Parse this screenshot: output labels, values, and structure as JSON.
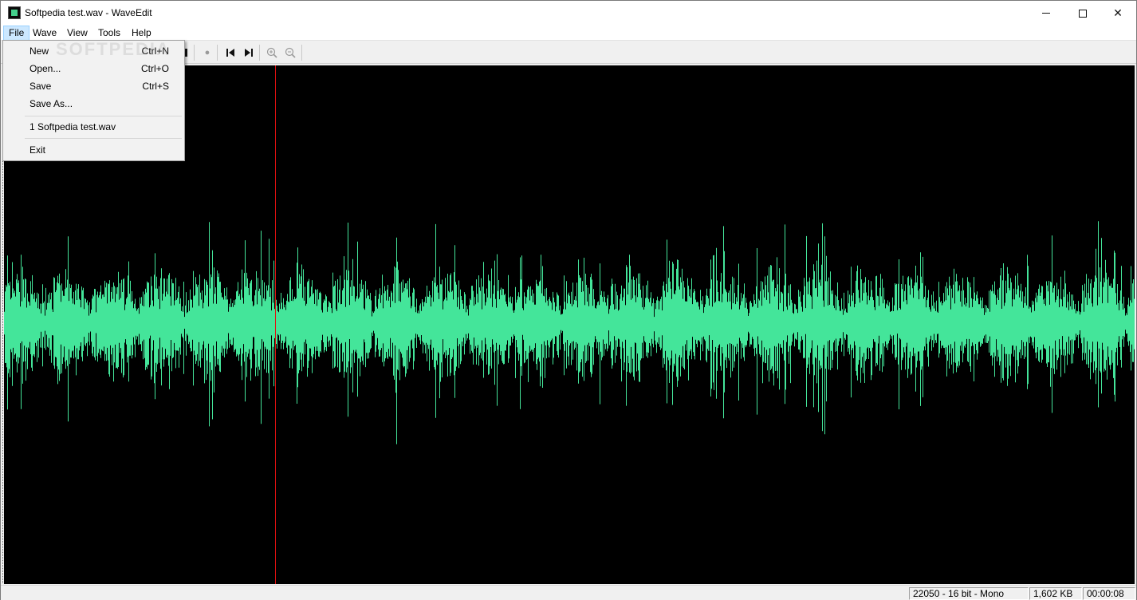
{
  "window": {
    "title": "Softpedia test.wav - WaveEdit",
    "icon": "waveedit-app-icon"
  },
  "caption_buttons": {
    "minimize": "minimize-icon",
    "maximize": "maximize-icon",
    "close": "close-icon",
    "close_glyph": "✕"
  },
  "menubar": {
    "items": [
      {
        "label": "File"
      },
      {
        "label": "Wave"
      },
      {
        "label": "View"
      },
      {
        "label": "Tools"
      },
      {
        "label": "Help"
      }
    ],
    "active": "File"
  },
  "toolbar": {
    "items": [
      {
        "icon": "record-icon",
        "glyph": "●",
        "enabled": false
      },
      {
        "icon": "skip-to-start-icon",
        "glyph": "⏮",
        "enabled": true
      },
      {
        "icon": "skip-to-end-icon",
        "glyph": "⏭",
        "enabled": true
      },
      {
        "icon": "zoom-in-icon",
        "glyph": "⊕",
        "enabled": false
      },
      {
        "icon": "zoom-out-icon",
        "glyph": "⊖",
        "enabled": false
      }
    ]
  },
  "file_menu": {
    "items": [
      {
        "label": "New",
        "shortcut": "Ctrl+N"
      },
      {
        "label": "Open...",
        "shortcut": "Ctrl+O"
      },
      {
        "label": "Save",
        "shortcut": "Ctrl+S"
      },
      {
        "label": "Save As...",
        "shortcut": ""
      },
      {
        "label": "1 Softpedia test.wav",
        "shortcut": ""
      },
      {
        "label": "Exit",
        "shortcut": ""
      }
    ]
  },
  "waveform": {
    "background_color": "#000000",
    "wave_color": "#44e59a",
    "cursor_color": "#e01010",
    "cursor_position_fraction": 0.24
  },
  "statusbar": {
    "format": "22050 - 16 bit - Mono",
    "size": "1,602 KB",
    "duration": "00:00:08"
  },
  "watermark": "SOFTPEDIA"
}
